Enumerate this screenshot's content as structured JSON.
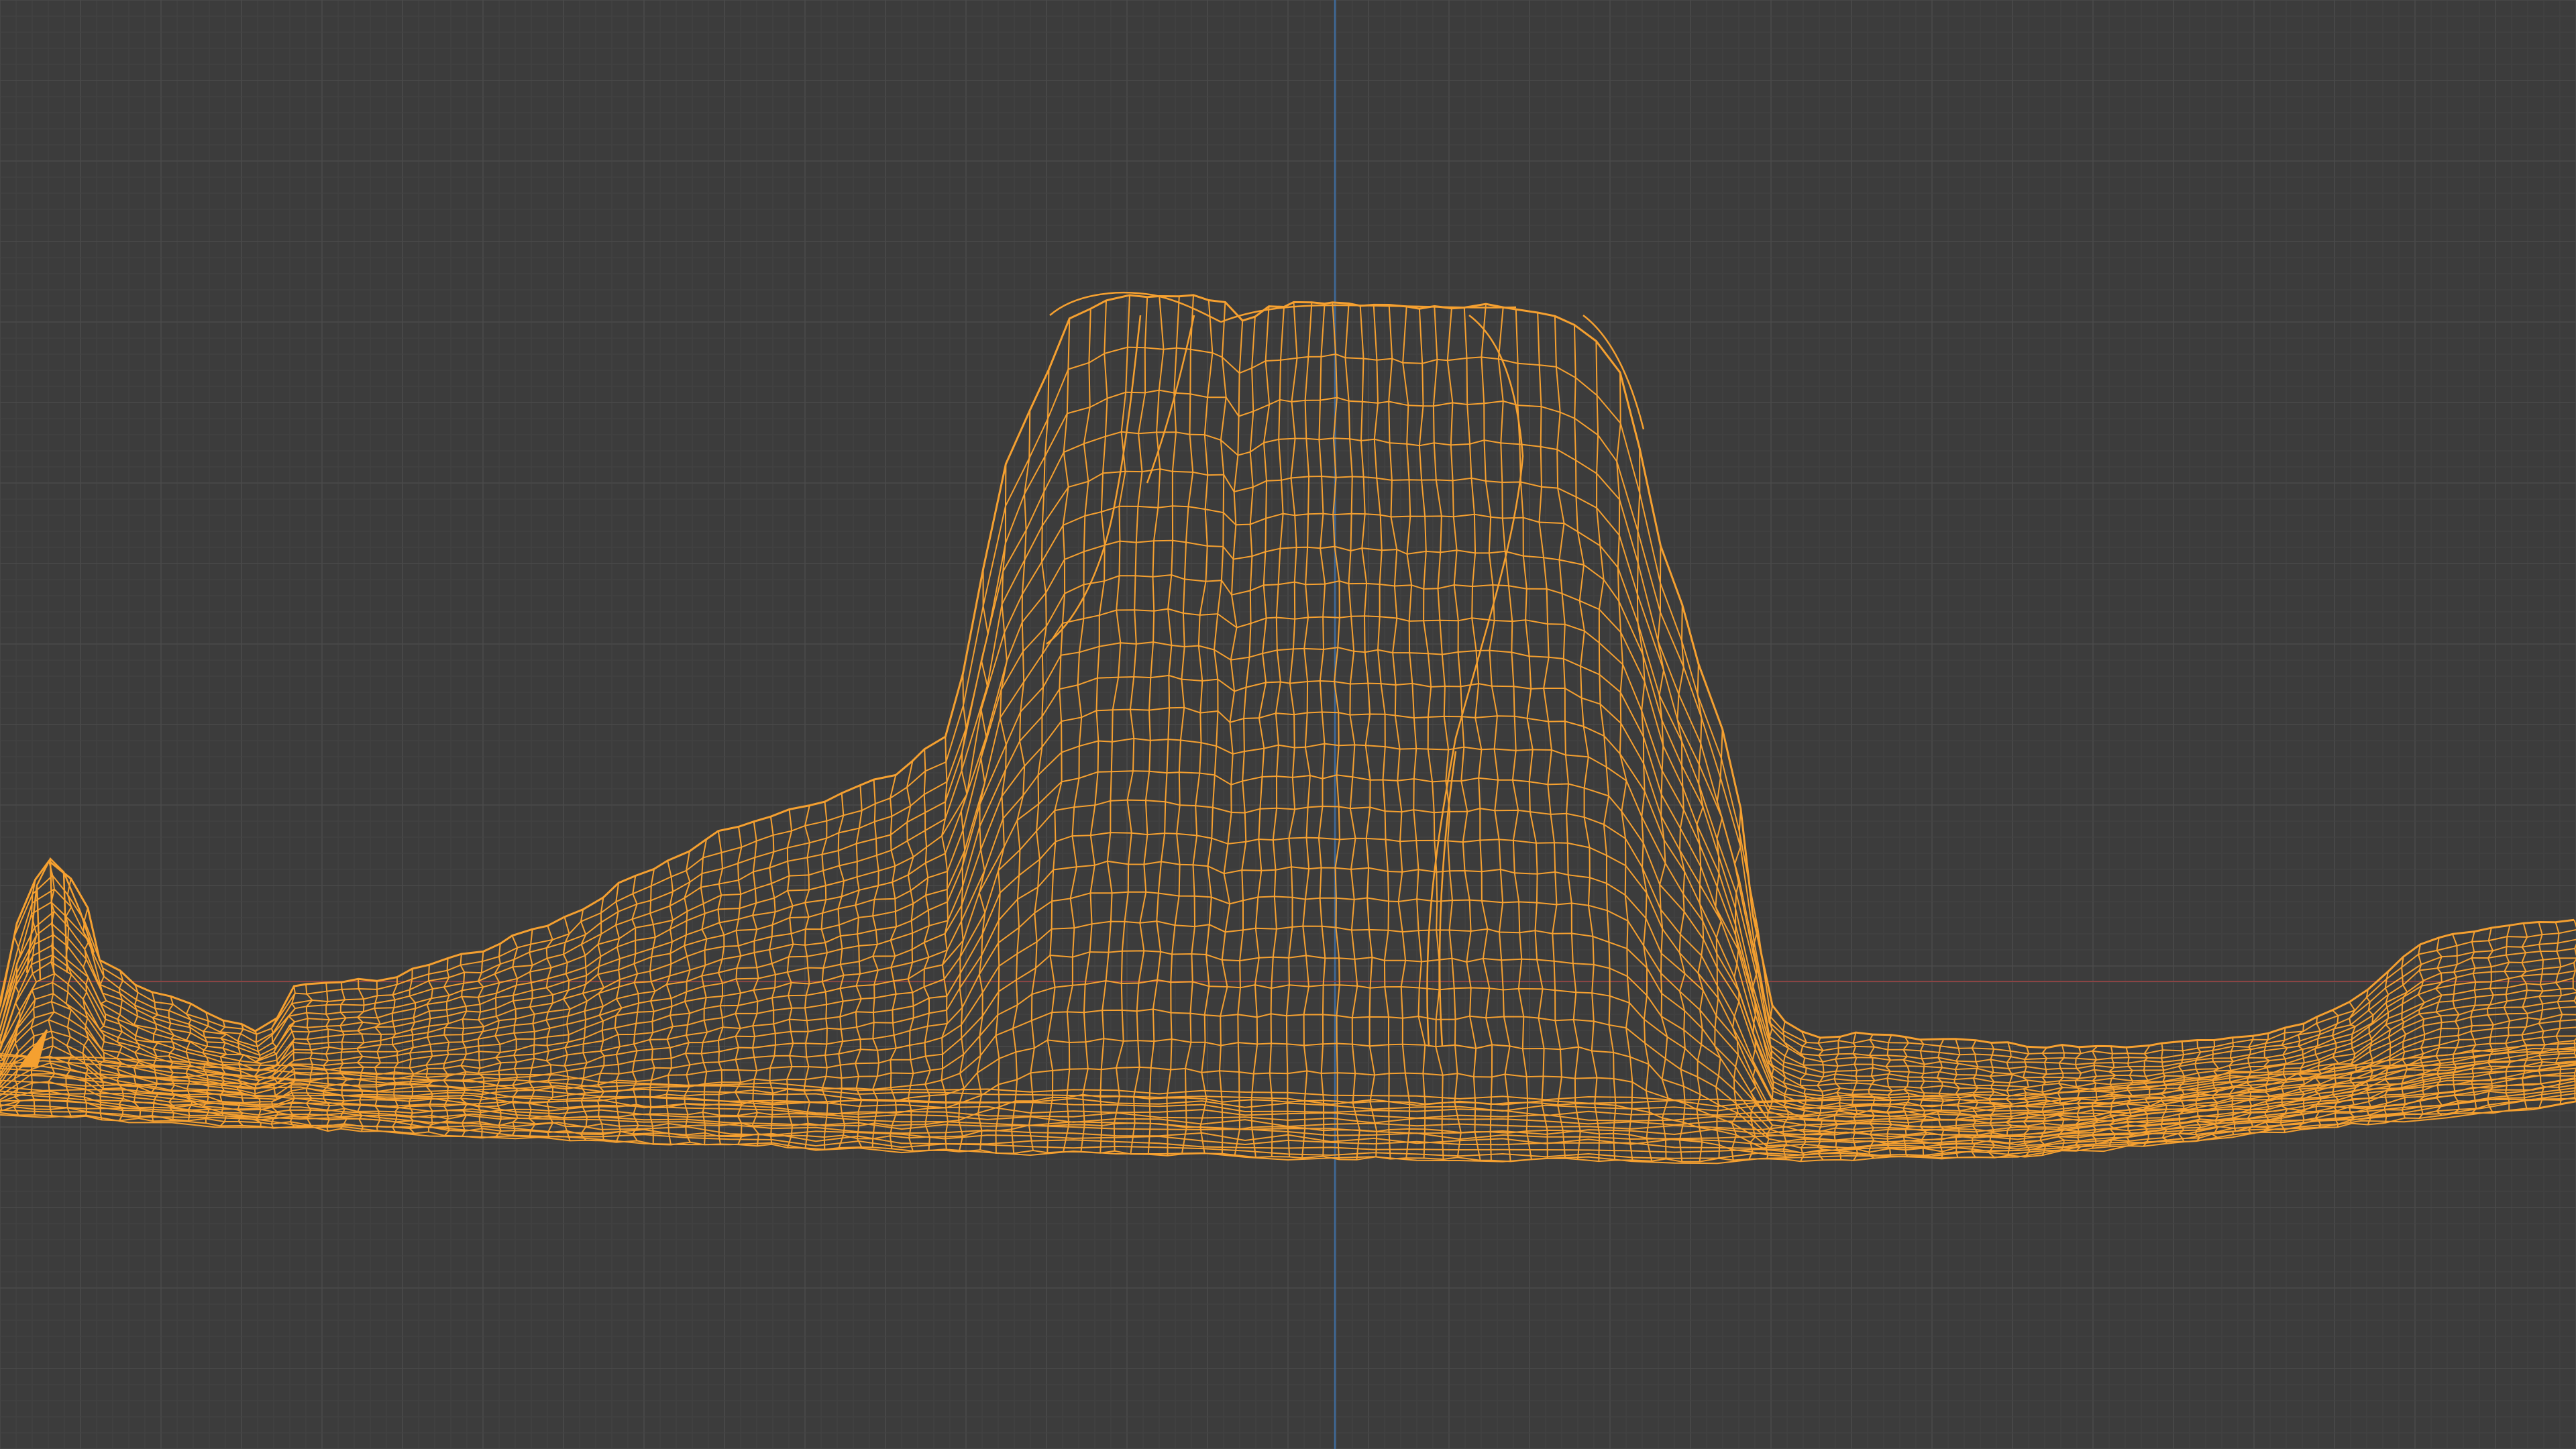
{
  "viewport": {
    "mode": "wireframe",
    "background_color": "#3c3c3c",
    "grid_minor_color": "#434343",
    "grid_major_color": "#4a4a4a",
    "axis_x_color": "#8a4444",
    "axis_z_color": "#3f6a9a",
    "wireframe_color": "#f5a030",
    "selected_object": "terrain-mesh"
  }
}
